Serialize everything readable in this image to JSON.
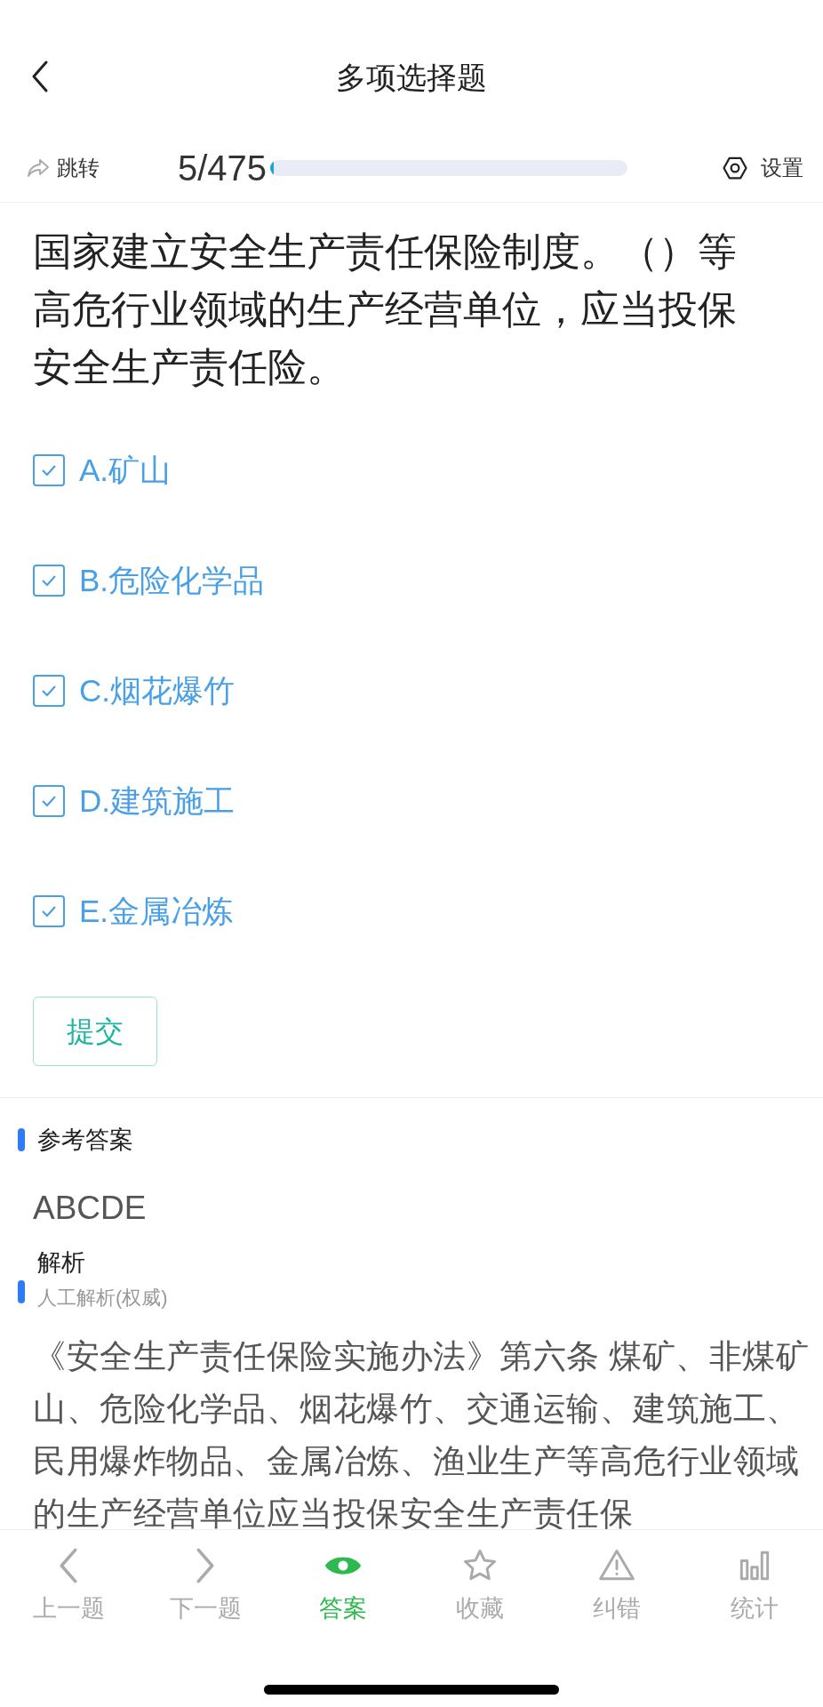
{
  "header": {
    "title": "多项选择题"
  },
  "toolbar": {
    "jump": "跳转",
    "counter": "5/475",
    "progress": {
      "level": 0.0105
    },
    "settings": "设置"
  },
  "question": "国家建立安全生产责任保险制度。（）等高危行业领域的生产经营单位，应当投保安全生产责任险。",
  "options": [
    {
      "label": "A.矿山",
      "checked": true
    },
    {
      "label": "B.危险化学品",
      "checked": true
    },
    {
      "label": "C.烟花爆竹",
      "checked": true
    },
    {
      "label": "D.建筑施工",
      "checked": true
    },
    {
      "label": "E.金属冶炼",
      "checked": true
    }
  ],
  "submit": "提交",
  "answer": {
    "heading": "参考答案",
    "value": "ABCDE"
  },
  "analysis": {
    "heading": "解析",
    "source": "人工解析(权威)",
    "text": "《安全生产责任保险实施办法》第六条 煤矿、非煤矿山、危险化学品、烟花爆竹、交通运输、建筑施工、民用爆炸物品、金属冶炼、渔业生产等高危行业领域的生产经营单位应当投保安全生产责任保"
  },
  "bottom_nav": [
    {
      "kind": "prev",
      "label": "上一题",
      "selected": false
    },
    {
      "kind": "next",
      "label": "下一题",
      "selected": false
    },
    {
      "kind": "answer",
      "label": "答案",
      "selected": true
    },
    {
      "kind": "favorite",
      "label": "收藏",
      "selected": false
    },
    {
      "kind": "report",
      "label": "纠错",
      "selected": false
    },
    {
      "kind": "stats",
      "label": "统计",
      "selected": false
    }
  ]
}
